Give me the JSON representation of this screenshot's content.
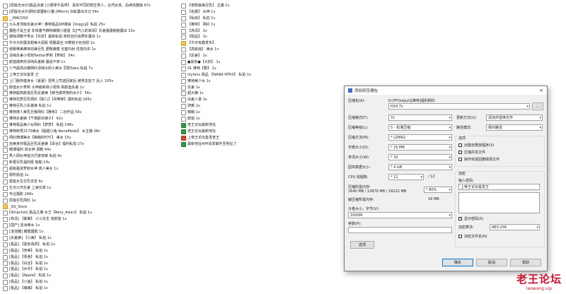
{
  "left_column": [
    {
      "icon": "file",
      "text": "[原版无水印]极品泳装 [小胆球不是乖】 喜欢不同的陪生男人，台湾女孩，后续完整版 67v"
    },
    {
      "icon": "file",
      "text": "[原版无水印]网红狐狸和小猫 [Mikmi] 出轨露出日记 54v"
    },
    {
      "icon": "folder",
      "text": "__MACOSX"
    },
    {
      "icon": "file",
      "text": "九头身顶级反差女神！推特极品SM爆操【mqgcp】私拍 25v"
    },
    {
      "icon": "file",
      "text": "露脸才是王道 非常骚气推特嫩模小姐姐【过气儿的高哥】反差骚骚啪啪露出 33v"
    },
    {
      "icon": "file",
      "text": "爆操调教不乖女【许愿】最新私拍 和粉丝约会野外露出 1v"
    },
    {
      "icon": "file",
      "text": "牛仔大奶骚货甜美大屁股 情趣黑丝 对着镜子玩自慰 1v"
    },
    {
      "icon": "file",
      "text": "極致唯美推特完美巨乳 肥臀嫩模 无套内射 性感内衣 1v"
    },
    {
      "icon": "file",
      "text": "清纯反差小母狗Twitter萝莉【萝莉】 54v"
    },
    {
      "icon": "file",
      "text": "颜值爆表的清纯反差婊 骚逼不停 1v"
    },
    {
      "icon": "file",
      "text": "人气超高白嫩网红清纯大奶小美女 同款Saku 私拍 7v"
    },
    {
      "icon": "file",
      "text": "上帝王论坛首发 王"
    },
    {
      "icon": "file",
      "text": "上门服务健身女《夏夏》把男上司送回家后 被男友拍下 后入 105v"
    },
    {
      "icon": "file",
      "text": "颜值女仆萝莉 大神最新搞小母狗 高颜值反差 1v"
    },
    {
      "icon": "file",
      "text": "推特超高颜值巨乳反差婊【被当做宠物的女仆】 56v"
    },
    {
      "icon": "file",
      "text": "推特优质巨乳网红【梨儿】【吊带袜】福利私拍 165v"
    },
    {
      "icon": "file",
      "text": "推特巨乳小反差婊 私拍 1v"
    },
    {
      "icon": "file",
      "text": "推特撩人美乳巨臀网红【雅希】 二创作品 56v"
    },
    {
      "icon": "file",
      "text": "推特反差婊【千粥欧买婊子】 62v"
    },
    {
      "icon": "file",
      "text": "推特极品美少女网红【梦梦】 私拍 148v"
    },
    {
      "icon": "file",
      "text": "推特新秀2170美女【甜甜小兔-NanaMode】 女主播 38v"
    },
    {
      "icon": "file",
      "text": "网红微博美女【萌萌的叮叮】 美女 15v"
    },
    {
      "icon": "file",
      "text": "完美身材极品巨乳反差婊【百合】福利私拍 27v"
    },
    {
      "icon": "file",
      "text": "微博福利 双女神 调教 44v"
    },
    {
      "icon": "file",
      "text": "秀人网女神首次尺度突破 私拍 4v"
    },
    {
      "icon": "file",
      "text": "新晋巨乳福利姬 啪啪 14v"
    },
    {
      "icon": "file",
      "text": "超级骚货萝莉女神 真人美女 1v"
    },
    {
      "icon": "file",
      "text": "厕所偷拍 1v"
    },
    {
      "icon": "file",
      "text": "寝室女生巨乳吉吉 6v"
    },
    {
      "icon": "file",
      "text": "生日公开反差 上海交通 1v"
    },
    {
      "icon": "file",
      "text": "专业摄影 246v"
    },
    {
      "icon": "file",
      "text": "原版巨乳网红 1v"
    },
    {
      "icon": "folder",
      "text": "_DS_Store"
    },
    {
      "icon": "file",
      "text": "[Stripchat] 极品主播 女王【Nery_Asian】 私拍 1v"
    },
    {
      "icon": "file",
      "text": "[高清] 【紫藤】 小三先生 高颜值 1v"
    },
    {
      "icon": "file",
      "text": "[国产] 亚洲美女 1v"
    },
    {
      "icon": "file",
      "text": "[泡泡糖] 嫩模露脸 1v"
    },
    {
      "icon": "file",
      "text": "[反差婊] 【小美】 私拍 1v"
    },
    {
      "icon": "file",
      "text": "[极品] 【黑色毒药】 私拍 1v"
    },
    {
      "icon": "file",
      "text": "[极品] 【奈美】 私拍 1v"
    },
    {
      "icon": "file",
      "text": "[极品] 【零食】 私拍 1v"
    },
    {
      "icon": "file",
      "text": "[极品] 【白丝】 私拍 1v"
    },
    {
      "icon": "file",
      "text": "[极品] 【水手】 私拍 1v"
    },
    {
      "icon": "file",
      "text": "[极品] 【Apple】 私拍 1v"
    },
    {
      "icon": "file",
      "text": "[极品] 【小鱼】 私拍 1v"
    },
    {
      "icon": "file",
      "text": "[极品] 【萌萌】 私拍 1v"
    }
  ],
  "right_column": [
    {
      "icon": "file",
      "text": "【老師最美巨乳】 主播 1v"
    },
    {
      "icon": "file",
      "text": "【名媛】 女神 1v"
    },
    {
      "icon": "file",
      "text": "【私房】 私拍 1v"
    },
    {
      "icon": "file",
      "text": "【推特】 网红 1v"
    },
    {
      "icon": "file",
      "text": "【高清】 1v"
    },
    {
      "icon": "file",
      "text": "【極品】 1v"
    },
    {
      "icon": "folder",
      "text": "【今天有趣发布】"
    },
    {
      "icon": "file",
      "text": "【高颜值】 美女 1v"
    },
    {
      "icon": "file",
      "text": "【反差】 1v"
    },
    {
      "icon": "file",
      "text": "●黑色●【大奶】 1v"
    },
    {
      "icon": "file",
      "text": "91 推特【雅】 1v"
    },
    {
      "icon": "file",
      "text": "nlyfans 极品 【NANA NTR3】 私拍 1v"
    },
    {
      "icon": "file",
      "text": "推特美少女 1v"
    },
    {
      "icon": "file",
      "text": "反差 1v"
    },
    {
      "icon": "file",
      "text": "超大胸 1v"
    },
    {
      "icon": "file",
      "text": "出差人妻 1v"
    },
    {
      "icon": "file",
      "text": "骑乘 1v"
    },
    {
      "icon": "file",
      "text": "萌萌 1v"
    },
    {
      "icon": "file",
      "text": "颜值 1v"
    },
    {
      "icon": "grn",
      "text": "老王论坛最新地址"
    },
    {
      "icon": "grn",
      "text": "老王论坛最新地址"
    },
    {
      "icon": "red",
      "text": "上帝王论坛首发老王"
    },
    {
      "icon": "grn",
      "text": "最新地址APP请发邮件至地址了"
    }
  ],
  "dialog": {
    "title": "添加到压缩包",
    "close": "×",
    "archive_label": "压缩包(A):",
    "archive_dir": "D:\\FFOutput\\[推特]福利网红",
    "archive_name": "H24.7z",
    "browse": "...",
    "format_label": "压缩格式(F):",
    "format_value": "7z",
    "level_label": "压缩等级(L):",
    "level_value": "5 - 标准压缩",
    "method_label": "压缩方法(M):",
    "method_value": "* LZMA2",
    "dict_label": "字典大小(D):",
    "dict_value": "* 16 MB",
    "word_label": "单词大小(W):",
    "word_value": "* 32",
    "solid_label": "固实数据大小:",
    "solid_value": "* 4 GB",
    "cpu_label": "CPU 线程数:",
    "cpu_value": "* 12",
    "cpu_total": "/ 12",
    "mem_label": "压缩所需内存:",
    "mem_value": "1640 MB / 12870 MB / 16222 MB",
    "mem_pct": "* 80%",
    "dmem_label": "解压缩所需内存:",
    "dmem_value": "18 MB",
    "split_label": "分卷大小，字节(V):",
    "split_value": "1000M",
    "params_label": "参数(P):",
    "options_button": "选项",
    "update_label": "更新方式(U):",
    "update_value": "添加并替换文件",
    "path_label": "路径模式:",
    "path_value": "相对路径",
    "opt_group": "选项",
    "opt_sfx": "创建自释放程序(X)",
    "opt_shared": "压缩共享文件",
    "opt_delete": "操作完成后删除源文件",
    "enc_group": "加密",
    "pwd_label": "输入密码:",
    "pwd_value": "上帝王论坛首发王",
    "show_pwd": "显示密码(S)",
    "enc_method_label": "加密算法:",
    "enc_method_value": "AES-256",
    "enc_names": "加密文件名(N)",
    "ok": "确定",
    "cancel": "取消",
    "help": "帮助"
  },
  "watermark": {
    "line1": "老王论坛",
    "line2": "laowang.vip"
  }
}
